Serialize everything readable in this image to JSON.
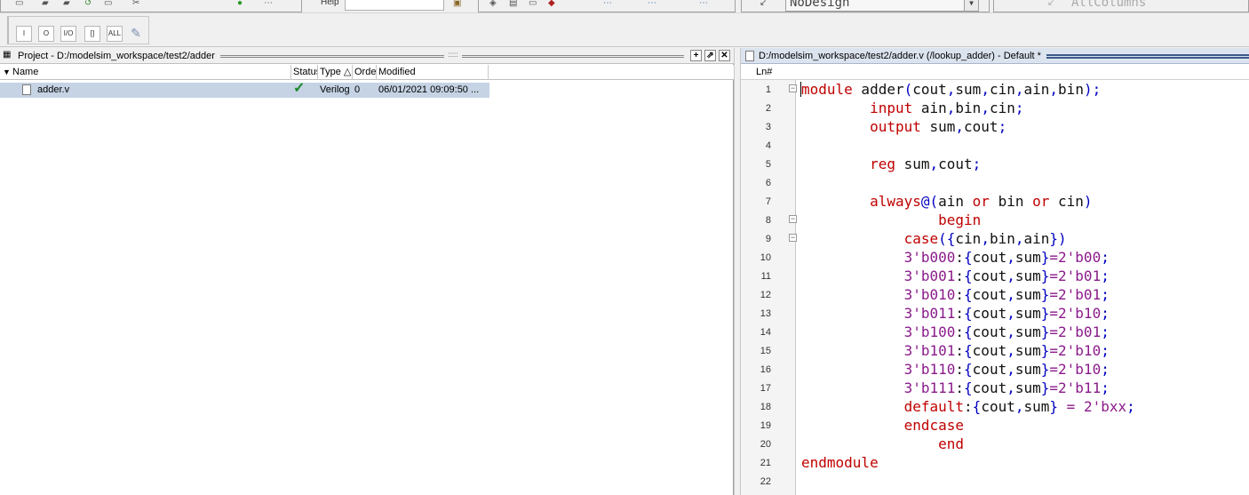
{
  "toolbar": {
    "help_label": "Help",
    "design_select": "NoDesign",
    "columns_box": "AllColumns",
    "tb2_buttons": [
      "I",
      "O",
      "I/O",
      "[]",
      "ALL"
    ]
  },
  "project": {
    "title": "Project - D:/modelsim_workspace/test2/adder",
    "columns": [
      "Name",
      "Status",
      "Type",
      "Order",
      "Modified"
    ],
    "rows": [
      {
        "name": "adder.v",
        "status": "✓",
        "type": "Verilog",
        "order": "0",
        "modified": "06/01/2021 09:09:50 ..."
      }
    ]
  },
  "source": {
    "title": "D:/modelsim_workspace/test2/adder.v (/lookup_adder) - Default *",
    "ln_header": "Ln#",
    "lines": [
      "module adder(cout,sum,cin,ain,bin);",
      "        input ain,bin,cin;",
      "        output sum,cout;",
      "",
      "        reg sum,cout;",
      "",
      "        always@(ain or bin or cin)",
      "                begin",
      "            case({cin,bin,ain})",
      "            3'b000:{cout,sum}=2'b00;",
      "            3'b001:{cout,sum}=2'b01;",
      "            3'b010:{cout,sum}=2'b01;",
      "            3'b011:{cout,sum}=2'b10;",
      "            3'b100:{cout,sum}=2'b01;",
      "            3'b101:{cout,sum}=2'b10;",
      "            3'b110:{cout,sum}=2'b10;",
      "            3'b111:{cout,sum}=2'b11;",
      "            default:{cout,sum} = 2'bxx;",
      "            endcase",
      "                end",
      "endmodule",
      ""
    ]
  }
}
